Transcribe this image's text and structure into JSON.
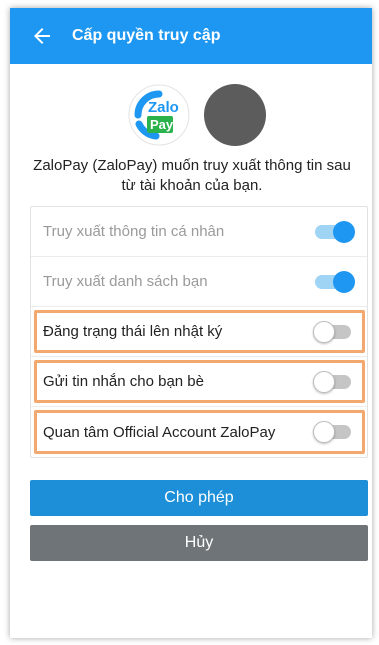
{
  "header": {
    "title": "Cấp quyền truy cập",
    "back_icon": "arrow-left-icon",
    "color": "#1e97f2"
  },
  "app": {
    "logo_text_top": "Zalo",
    "logo_text_bottom": "Pay",
    "description": "ZaloPay (ZaloPay) muốn truy xuất thông tin sau từ tài khoản của bạn."
  },
  "permissions": [
    {
      "label": "Truy xuất thông tin cá nhân",
      "enabled": true,
      "editable": false
    },
    {
      "label": "Truy xuất danh sách bạn",
      "enabled": true,
      "editable": false
    },
    {
      "label": "Đăng trạng thái lên nhật ký",
      "enabled": false,
      "editable": true
    },
    {
      "label": "Gửi tin nhắn cho bạn bè",
      "enabled": false,
      "editable": true
    },
    {
      "label": "Quan tâm Official Account ZaloPay",
      "enabled": false,
      "editable": true
    }
  ],
  "actions": {
    "allow_label": "Cho phép",
    "cancel_label": "Hủy"
  },
  "colors": {
    "accent": "#1e97f2",
    "allow_button": "#1c8fd8",
    "cancel_button": "#6e7478",
    "highlight": "#f2a86e"
  }
}
